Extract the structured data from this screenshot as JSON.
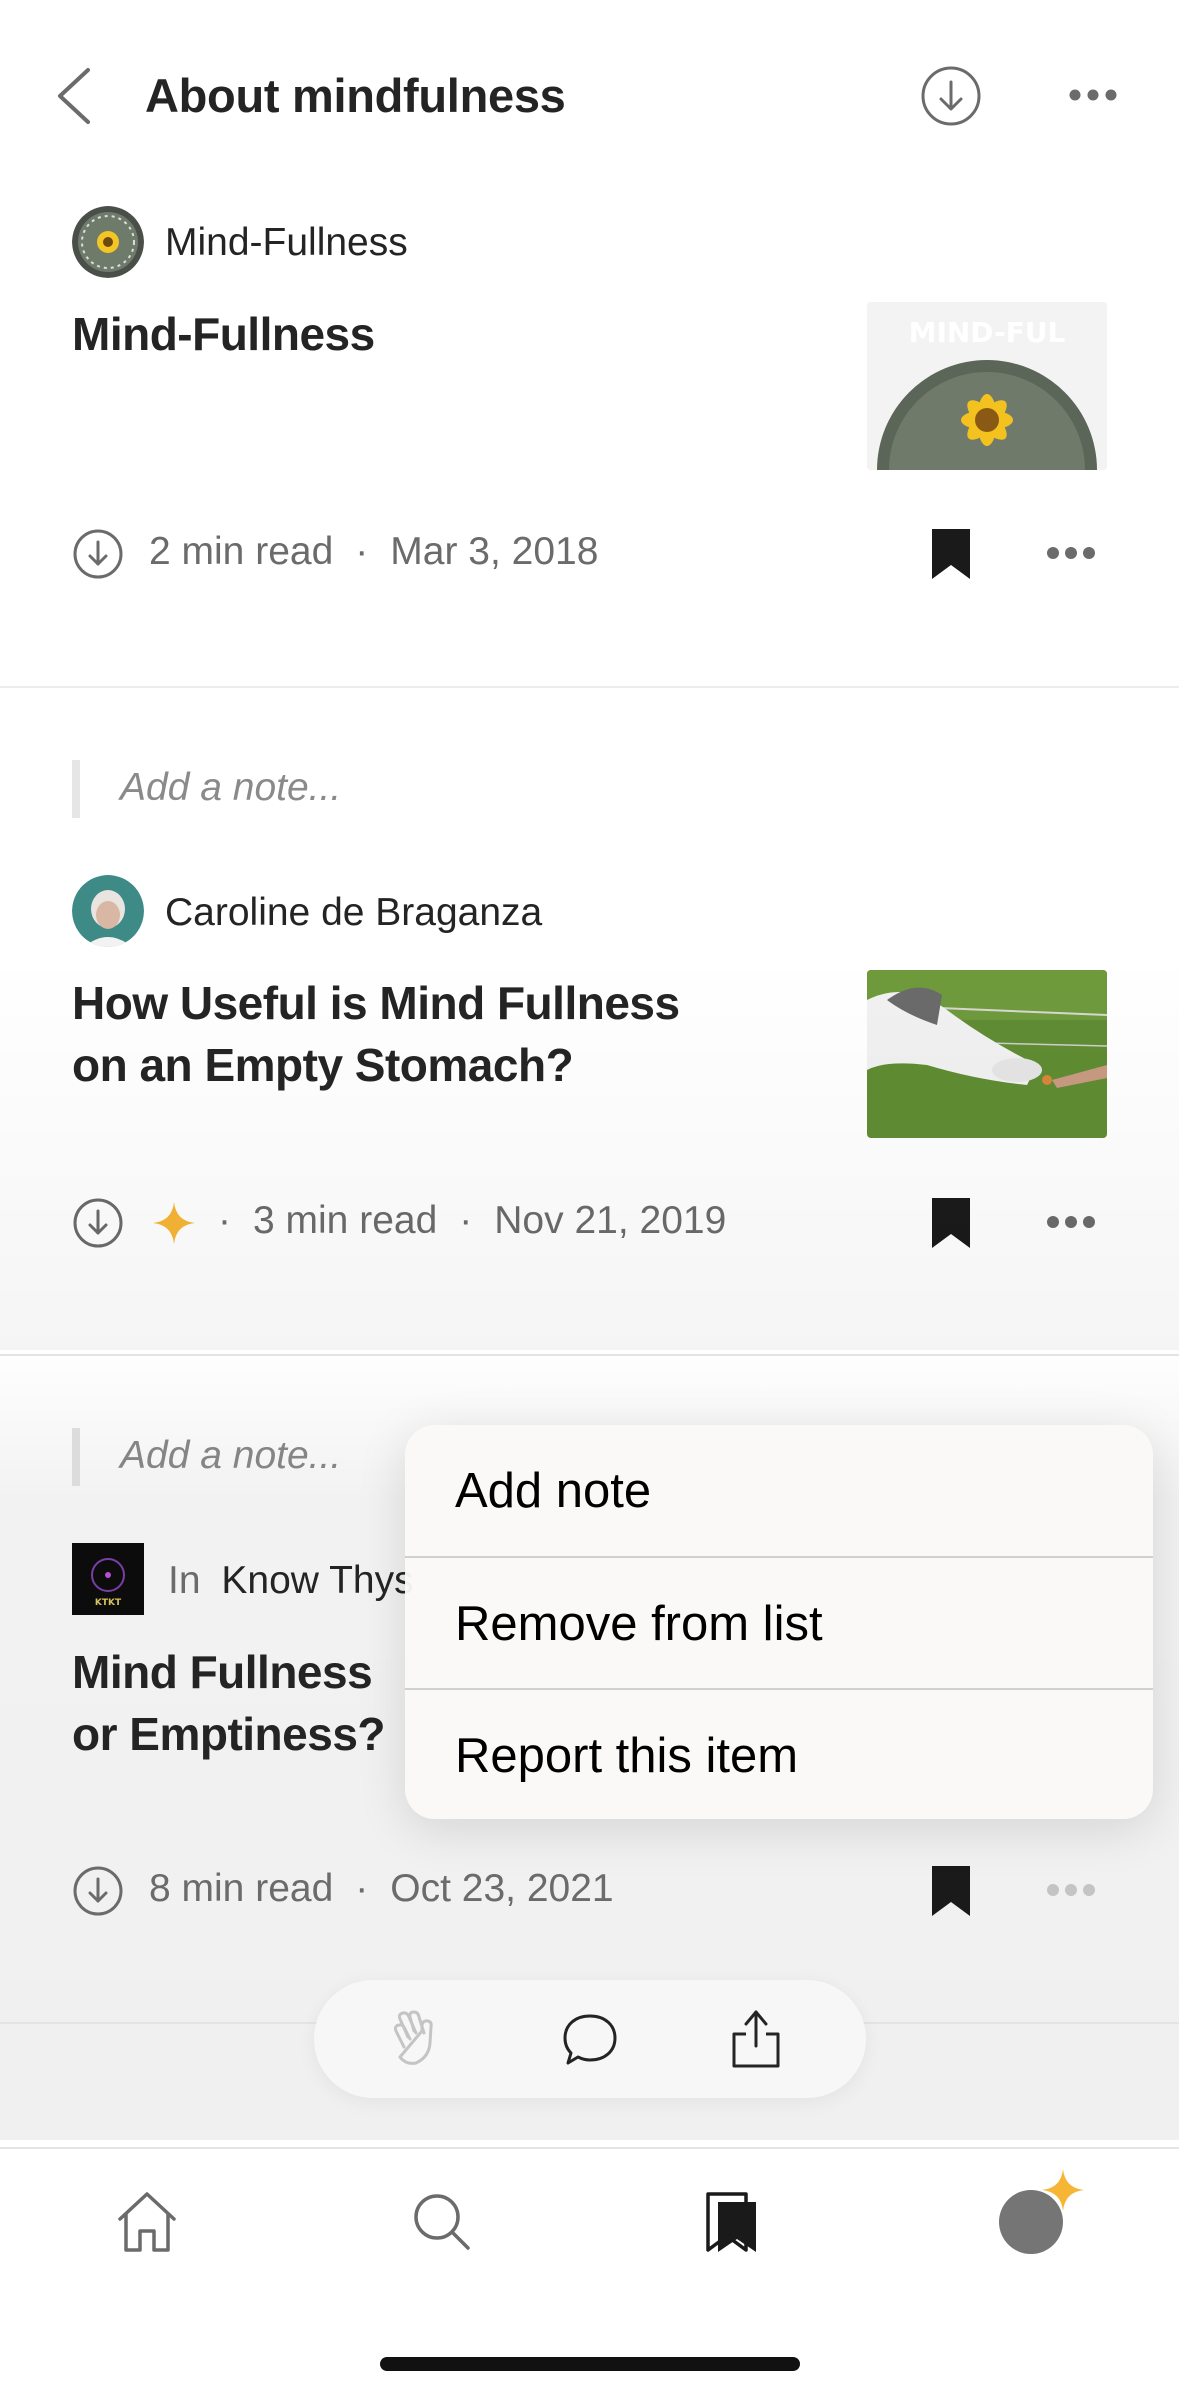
{
  "header": {
    "title": "About mindfulness",
    "back_icon": "chevron-left-icon",
    "download_icon": "download-circle-icon",
    "more_icon": "more-horizontal-icon"
  },
  "items": [
    {
      "author": "Mind-Fullness",
      "title": "Mind-Fullness",
      "read_time": "2 min read",
      "date": "Mar 3, 2018",
      "thumb_text": "MIND-FUL"
    },
    {
      "note_placeholder": "Add a note...",
      "author": "Caroline de Braganza",
      "title_line1": "How Useful is Mind Fullness",
      "title_line2": "on an Empty Stomach?",
      "member_only": true,
      "read_time": "3 min read",
      "date": "Nov 21, 2019"
    },
    {
      "note_placeholder": "Add a note...",
      "publication_prefix": "In",
      "publication": "Know Thys",
      "publication_logo_text": "KTKT",
      "title_line1": "Mind Fullness",
      "title_line2": "or Emptiness?",
      "read_time": "8 min read",
      "date": "Oct 23, 2021"
    }
  ],
  "context_menu": {
    "items": [
      "Add note",
      "Remove from list",
      "Report this item"
    ]
  },
  "action_bar": {
    "icons": [
      "clap-icon",
      "comment-icon",
      "share-icon"
    ]
  },
  "tabbar": {
    "icons": [
      "home-icon",
      "search-icon",
      "bookmarks-icon",
      "profile-avatar-icon"
    ]
  },
  "colors": {
    "accent_star": "#f6b534",
    "text": "#242424",
    "muted": "#6b6b6b"
  }
}
